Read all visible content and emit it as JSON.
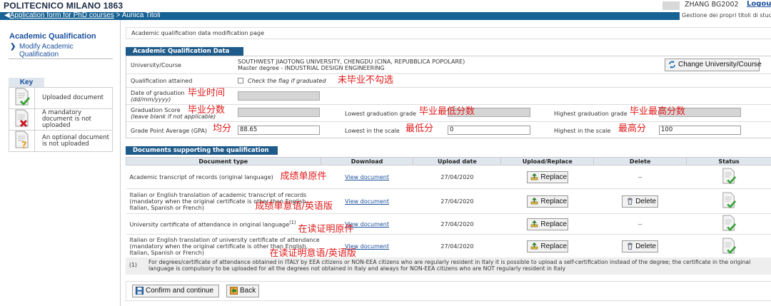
{
  "header": {
    "logo": "POLITECNICO MILANO 1863",
    "username": "ZHANG BG2002",
    "logout": "Logout",
    "subtitle": "Gestione dei propri titoli di studio",
    "breadcrumb_link": "Application form for PhD courses",
    "breadcrumb_sep": ">",
    "breadcrumb_current": "Aunica Titoli"
  },
  "sidebar": {
    "title": "Academic Qualification",
    "link": "Modify Academic Qualification",
    "key_label": "Key",
    "key_items": [
      {
        "icon": "uploaded-document-icon",
        "text": "Uploaded document"
      },
      {
        "icon": "mandatory-missing-icon",
        "text": "A mandatory document is not uploaded"
      },
      {
        "icon": "optional-missing-icon",
        "text": "An optional document is not uploaded"
      }
    ]
  },
  "page": {
    "heading": "Academic qualification data modification page",
    "section1_tab": "Academic Qualification Data",
    "university_label": "University/Course",
    "university_line1": "SOUTHWEST JIAOTONG UNIVERSITY, CHENGDU (CINA, REPUBBLICA POPOLARE)",
    "university_line2": "Master degree - INDUSTRIAL DESIGN ENGINEERING",
    "change_button": "Change University/Course",
    "qualification_label": "Qualification attained",
    "qualification_check": "Check the flag if graduated",
    "date_label_1": "Date of graduation",
    "date_label_2": "(dd/mm/yyyy)",
    "score_label_1": "Graduation Score",
    "score_label_2": "(leave blank if not applicable)",
    "lowest_grade_label": "Lowest graduation grade",
    "highest_grade_label": "Highest graduation grade",
    "gpa_label": "Grade Point Average (GPA)",
    "gpa_value": "88.65",
    "lowest_scale_label": "Lowest in the scale",
    "lowest_scale_value": "0",
    "highest_scale_label": "Highest in the scale",
    "highest_scale_value": "100",
    "section2_tab": "Documents supporting the qualification",
    "columns": [
      "Document type",
      "Download",
      "Upload date",
      "Upload/Replace",
      "Delete",
      "Status"
    ],
    "documents": [
      {
        "type": "Academic transcript of records (original language)",
        "download": "View document",
        "date": "27/04/2020",
        "upload": "Replace",
        "delete": "--"
      },
      {
        "type": "Italian or English translation of academic transcript of records (mandatory when the original certificate is other than English, Italian, Spanish or French)",
        "download": "View document",
        "date": "27/04/2020",
        "upload": "Replace",
        "delete": "Delete"
      },
      {
        "type": "University certificate of attendance in original language",
        "sup": "(1)",
        "download": "View document",
        "date": "27/04/2020",
        "upload": "Replace",
        "delete": "--"
      },
      {
        "type": "Italian or English translation of university certificate of attendance (mandatory when the original certificate is other than English, Italian, Spanish or French)",
        "download": "View document",
        "date": "27/04/2020",
        "upload": "Replace",
        "delete": "Delete"
      }
    ],
    "footnote_num": "(1)",
    "footnote": "For degrees/certificate of attendance obtained in ITALY by EEA citizens or NON-EEA citizens who are regularly resident in Italy it is possible to upload a self-certification instead of the degree; the certificate in the original language is compulsory to be uploaded for all the degrees not obtained in Italy and always for NON-EEA citizens who are NOT regularly resident in Italy",
    "confirm_button": "Confirm and continue",
    "back_button": "Back"
  },
  "annotations": {
    "not_graduated": "未毕业不勾选",
    "grad_date": "毕业时间",
    "grad_score": "毕业分数",
    "lowest_grade": "毕业最低分数",
    "highest_grade": "毕业最高分数",
    "gpa": "均分",
    "lowest_scale": "最低分",
    "highest_scale": "最高分",
    "doc1": "成绩单原件",
    "doc2": "成绩单意语/英语版",
    "doc3": "在读证明原件",
    "doc4": "在读证明意语/英语版"
  },
  "colors": {
    "nav": "#176294",
    "tab": "#1f5b8a",
    "annotation": "#e01a1a",
    "link": "#1a4f9c"
  }
}
